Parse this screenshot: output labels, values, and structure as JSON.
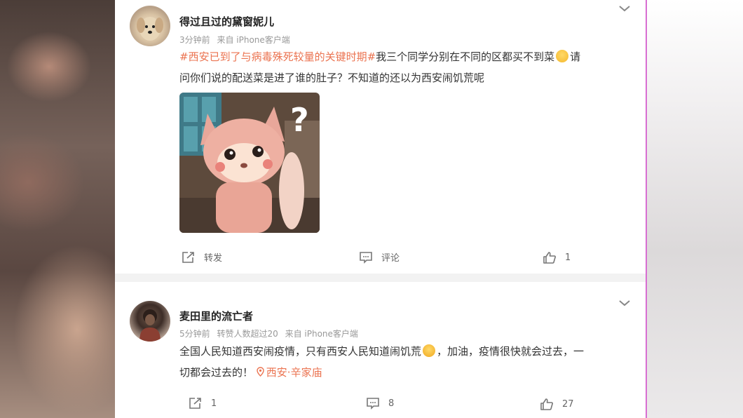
{
  "posts": [
    {
      "author": "得过且过的黛窗妮儿",
      "time": "3分钟前",
      "source": "来自 iPhone客户端",
      "hashtag": "#西安已到了与病毒殊死较量的关键时期#",
      "text_a": "我三个同学分别在不同的区都买不到菜",
      "text_b": "请",
      "text_c": "问你们说的配送菜是进了谁的肚子？不知道的还以为西安闹饥荒呢",
      "image_mark": "?",
      "repost_label": "转发",
      "comment_label": "评论",
      "like_count": "1"
    },
    {
      "author": "麦田里的流亡者",
      "time": "5分钟前",
      "reposts_note": "转赞人数超过20",
      "source": "来自 iPhone客户端",
      "text_a": "全国人民知道西安闹疫情，只有西安人民知道闹饥荒",
      "text_b": "，加油，疫情很快就会过去，一",
      "text_c": "切都会过去的！",
      "location": "西安·辛家庙",
      "repost_count": "1",
      "comment_count": "8",
      "like_count": "27"
    }
  ],
  "icons": [
    "chevron-down-icon",
    "avatar-dog",
    "avatar-person",
    "repost-icon",
    "comment-icon",
    "like-icon",
    "location-pin-icon",
    "grin-emoji",
    "tears-emoji"
  ],
  "colors": {
    "link": "#eb7350",
    "meta": "#999999",
    "text": "#333333"
  }
}
